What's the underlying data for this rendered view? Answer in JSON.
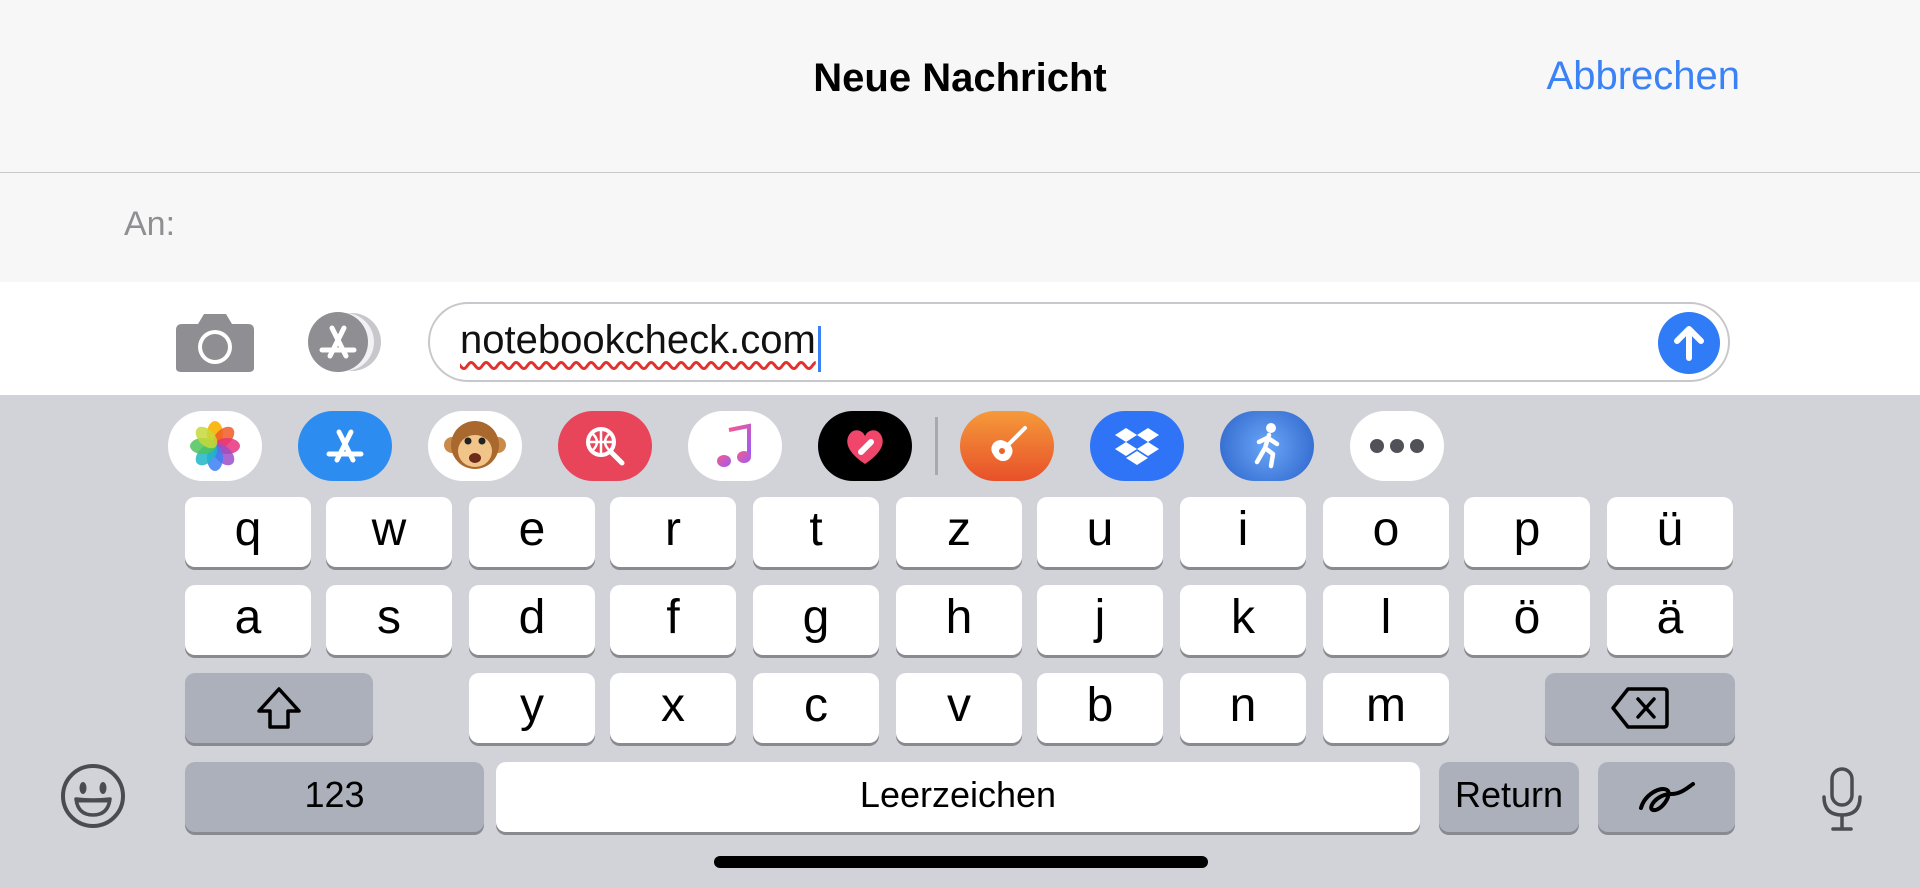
{
  "header": {
    "title": "Neue Nachricht",
    "cancel_label": "Abbrechen"
  },
  "recipient": {
    "label": "An:"
  },
  "composer": {
    "message_text": "notebookcheck.com"
  },
  "app_drawer": {
    "apps": [
      "photos-app",
      "app-store-app",
      "animoji-app",
      "search-images-app",
      "music-app",
      "digital-touch-app",
      "garageband-app",
      "dropbox-app",
      "fitness-run-app",
      "more-apps"
    ]
  },
  "keyboard": {
    "row1": [
      "q",
      "w",
      "e",
      "r",
      "t",
      "z",
      "u",
      "i",
      "o",
      "p",
      "ü"
    ],
    "row2": [
      "a",
      "s",
      "d",
      "f",
      "g",
      "h",
      "j",
      "k",
      "l",
      "ö",
      "ä"
    ],
    "row3": [
      "y",
      "x",
      "c",
      "v",
      "b",
      "n",
      "m"
    ],
    "numbers_label": "123",
    "space_label": "Leerzeichen",
    "return_label": "Return"
  },
  "colors": {
    "accent": "#3b82f6",
    "keyboard_bg": "#d1d3d9",
    "key_bg": "#ffffff",
    "fn_key_bg": "#abb0ba"
  }
}
